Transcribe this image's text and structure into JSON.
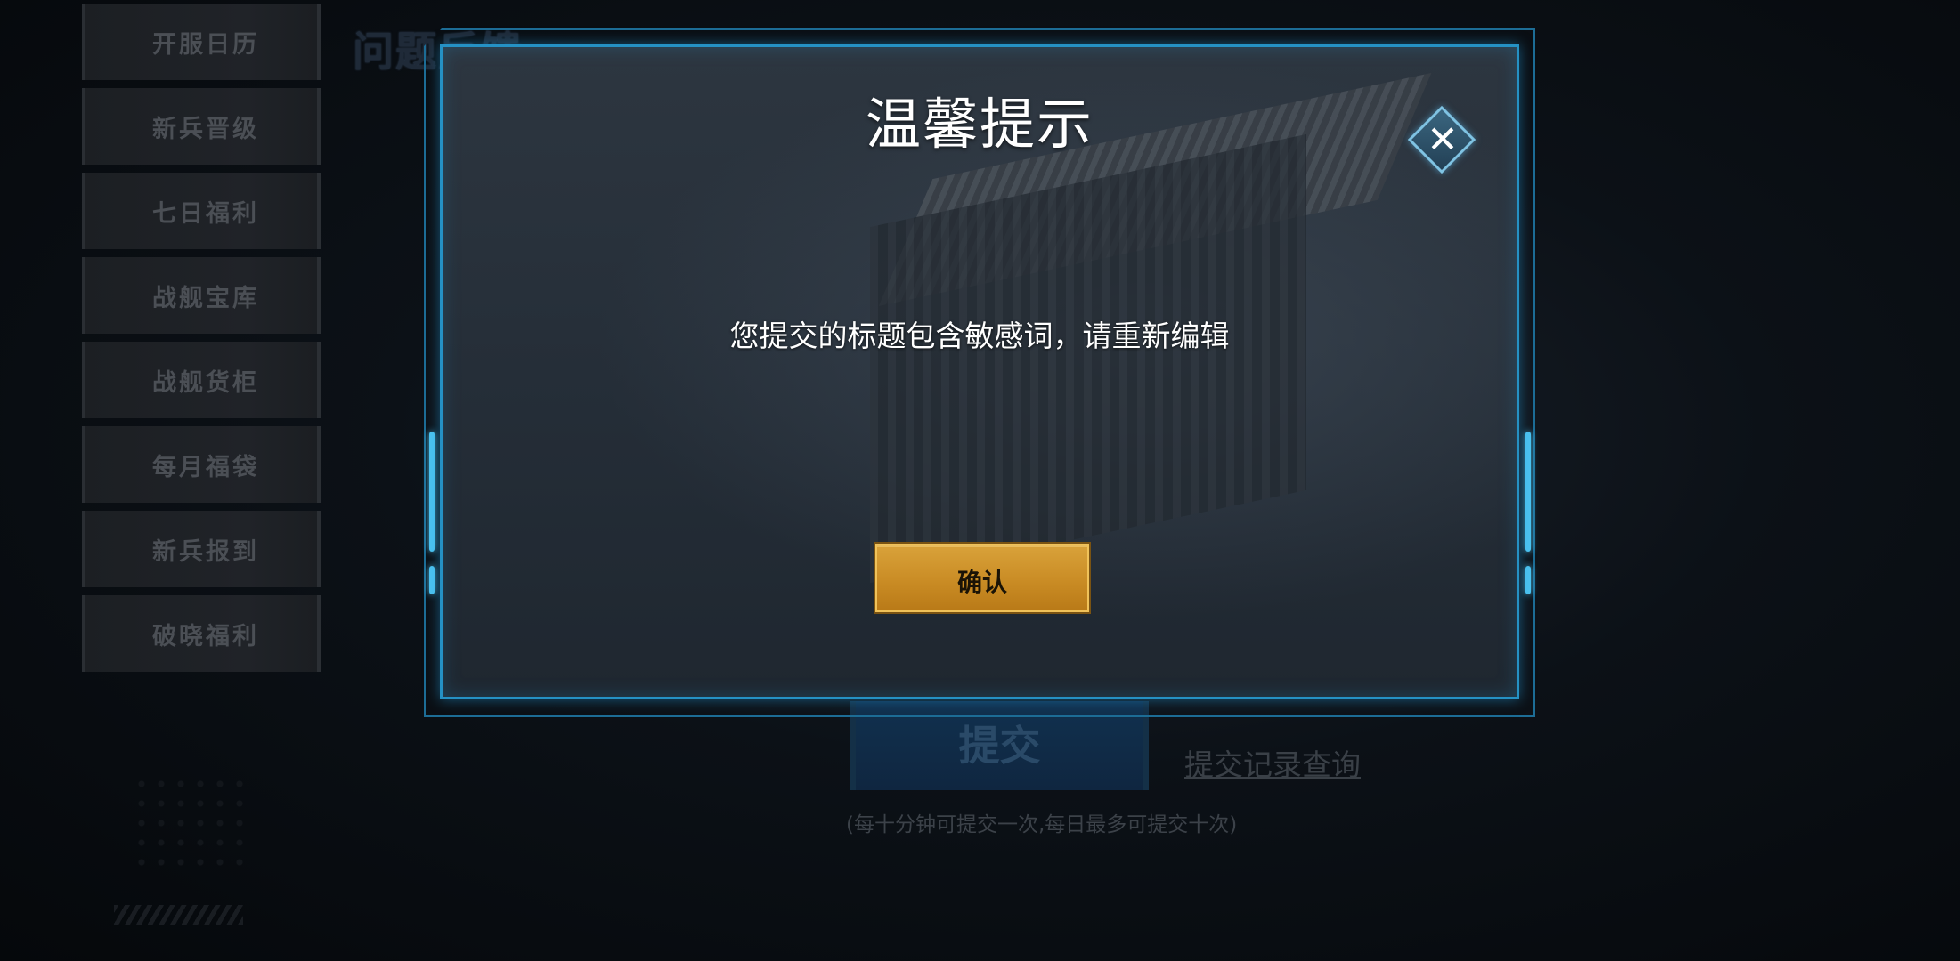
{
  "sidebar": {
    "items": [
      {
        "label": "开服日历"
      },
      {
        "label": "新兵晋级"
      },
      {
        "label": "七日福利"
      },
      {
        "label": "战舰宝库"
      },
      {
        "label": "战舰货柜"
      },
      {
        "label": "每月福袋"
      },
      {
        "label": "新兵报到"
      },
      {
        "label": "破晓福利"
      }
    ]
  },
  "background_page": {
    "title": "问题反馈",
    "submit_label": "提交",
    "record_link": "提交记录查询",
    "note": "(每十分钟可提交一次,每日最多可提交十次)"
  },
  "dialog": {
    "title": "温馨提示",
    "message": "您提交的标题包含敏感词，请重新编辑",
    "confirm_label": "确认",
    "close_icon": "close-icon"
  },
  "colors": {
    "frame_blue": "#2591c4",
    "confirm_gold": "#d9a23a",
    "title_white": "#ffffff"
  }
}
